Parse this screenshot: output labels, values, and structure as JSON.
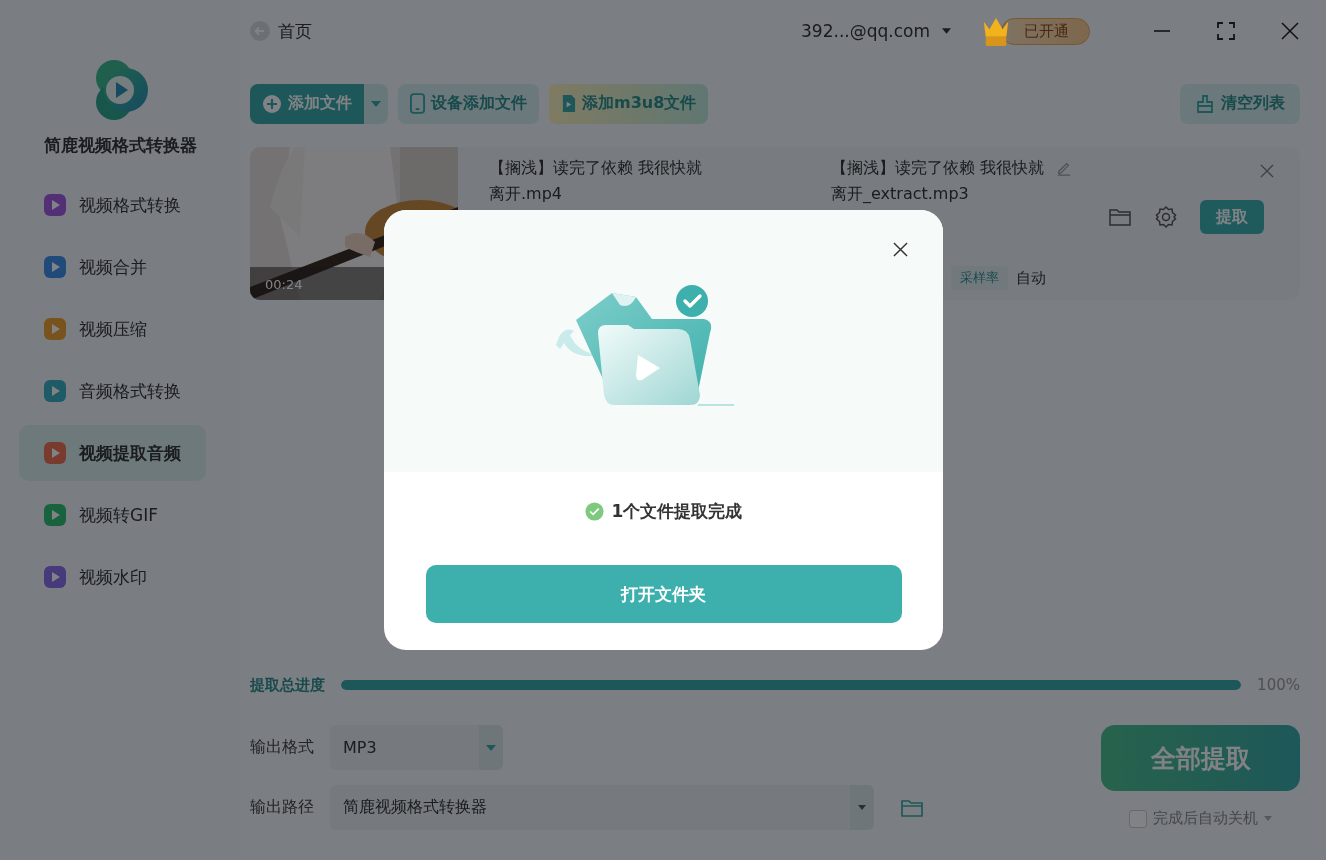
{
  "window": {
    "back_label": "首页",
    "account": "392...@qq.com",
    "vip_badge": "已开通"
  },
  "app": {
    "name": "简鹿视频格式转换器"
  },
  "sidebar": {
    "items": [
      {
        "label": "视频格式转换",
        "selected": false
      },
      {
        "label": "视频合并",
        "selected": false
      },
      {
        "label": "视频压缩",
        "selected": false
      },
      {
        "label": "音频格式转换",
        "selected": false
      },
      {
        "label": "视频提取音频",
        "selected": true
      },
      {
        "label": "视频转GIF",
        "selected": false
      },
      {
        "label": "视频水印",
        "selected": false
      }
    ]
  },
  "toolbar": {
    "buttons": [
      {
        "label": "添加文件",
        "kind": "primary"
      },
      {
        "label": "设备添加文件",
        "kind": "device"
      },
      {
        "label": "添加m3u8文件",
        "kind": "m3u8"
      }
    ],
    "clear_label": "清空列表"
  },
  "files": [
    {
      "duration": "00:24",
      "source_name": "【搁浅】读完了依赖 我很快就离开.mp4",
      "output_name": "【搁浅】读完了依赖 我很快就离开_extract.mp3",
      "extract_label": "提取",
      "sample_rate_label": "采样率",
      "sample_rate_value": "自动"
    }
  ],
  "progress": {
    "label": "提取总进度",
    "level": 1,
    "reading": "100%"
  },
  "output": {
    "format_label": "输出格式",
    "format": "MP3",
    "path_label": "输出路径",
    "path": "简鹿视频格式转换器",
    "extract_all": "全部提取",
    "shutdown": {
      "label": "完成后自动关机",
      "checked": false
    }
  },
  "dialog": {
    "message": "1个文件提取完成",
    "button": "打开文件夹"
  }
}
